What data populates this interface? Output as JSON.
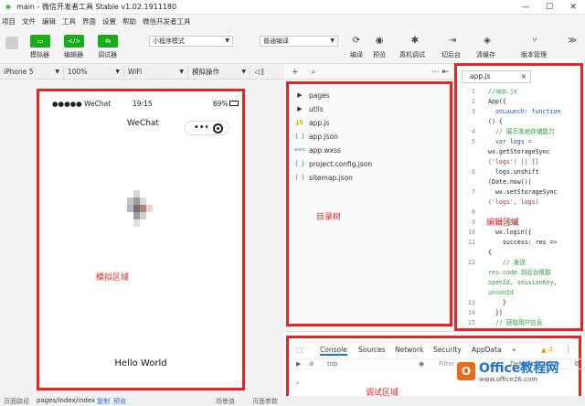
{
  "window": {
    "title": "main - 微信开发者工具 Stable v1.02.1911180",
    "minimize": "—",
    "maximize": "☐",
    "close": "✕"
  },
  "menu": [
    "项目",
    "文件",
    "编辑",
    "工具",
    "界面",
    "设置",
    "帮助",
    "微信开发者工具"
  ],
  "toolbar": {
    "simulator_label": "模拟器",
    "editor_label": "编辑器",
    "debugger_label": "调试器",
    "mode_select": "小程序模式",
    "compile_select": "普通编译",
    "compile_label": "编译",
    "preview_label": "预览",
    "remote_debug_label": "真机调试",
    "switch_bg_label": "切后台",
    "clear_cache_label": "清缓存",
    "version_label": "版本管理",
    "more": "≫"
  },
  "subbar": {
    "device": "iPhone 5",
    "zoom": "100%",
    "network": "WiFi",
    "sim_ops": "模拟操作"
  },
  "phone": {
    "carrier": "●●●●● WeChat",
    "time": "19:15",
    "battery": "69%",
    "nav_title": "WeChat",
    "capsule_dots": "•••",
    "hello": "Hello World"
  },
  "zones": {
    "sim": "模拟区域",
    "tree": "目录树",
    "editor": "编辑区域",
    "debug": "调试区域"
  },
  "tree": {
    "items": [
      {
        "icon": "▶",
        "name": "pages"
      },
      {
        "icon": "▶",
        "name": "utils"
      },
      {
        "icon": "JS",
        "name": "app.js"
      },
      {
        "icon": "{ }",
        "name": "app.json"
      },
      {
        "icon": "wxss",
        "name": "app.wxss"
      },
      {
        "icon": "{ }",
        "name": "project.config.json"
      },
      {
        "icon": "{ }",
        "name": "sitemap.json"
      }
    ]
  },
  "editor": {
    "tab": "app.js",
    "tab_close": "×",
    "lines": [
      {
        "n": "1",
        "t": "//app.js",
        "k": "comment"
      },
      {
        "n": "2",
        "t": "App({",
        "k": "plain"
      },
      {
        "n": "3",
        "t": "  onLaunch: function",
        "k": "kw"
      },
      {
        "n": "",
        "t": "() {",
        "k": "plain"
      },
      {
        "n": "4",
        "t": "  // 展示本地存储能力",
        "k": "comment"
      },
      {
        "n": "5",
        "t": "  var logs =",
        "k": "kw"
      },
      {
        "n": "",
        "t": "wx.getStorageSync",
        "k": "plain"
      },
      {
        "n": "",
        "t": "('logs') || []",
        "k": "str"
      },
      {
        "n": "6",
        "t": "  logs.unshift",
        "k": "plain"
      },
      {
        "n": "",
        "t": "(Date.now())",
        "k": "plain"
      },
      {
        "n": "7",
        "t": "  wx.setStorageSync",
        "k": "plain"
      },
      {
        "n": "",
        "t": "('logs', logs)",
        "k": "str"
      },
      {
        "n": "8",
        "t": "",
        "k": "plain"
      },
      {
        "n": "9",
        "t": "  // 登录",
        "k": "comment"
      },
      {
        "n": "10",
        "t": "  wx.login({",
        "k": "plain"
      },
      {
        "n": "11",
        "t": "    success: res =>",
        "k": "plain"
      },
      {
        "n": "",
        "t": "{",
        "k": "plain"
      },
      {
        "n": "12",
        "t": "    // 发送",
        "k": "comment"
      },
      {
        "n": "",
        "t": "res.code 到后台换取",
        "k": "comment"
      },
      {
        "n": "",
        "t": "openId, sessionKey,",
        "k": "comment"
      },
      {
        "n": "",
        "t": "unionId",
        "k": "comment"
      },
      {
        "n": "13",
        "t": "    }",
        "k": "plain"
      },
      {
        "n": "14",
        "t": "  })",
        "k": "plain"
      },
      {
        "n": "15",
        "t": "  // 获取用户信息",
        "k": "comment"
      }
    ]
  },
  "devtools": {
    "tabs": [
      "Console",
      "Sources",
      "Network",
      "Security",
      "AppData",
      "»"
    ],
    "warn_count": "4",
    "context": "top",
    "filter_placeholder": "Filter",
    "levels": "Default levels ▾",
    "prompt": "›"
  },
  "statusbar": {
    "path_label": "页面路径",
    "path": "pages/index/index",
    "copy": "复制",
    "preview": "预览",
    "scene": "场景值",
    "params": "页面参数"
  },
  "watermark": {
    "brand": "Office教程网",
    "url": "www.office26.com"
  }
}
